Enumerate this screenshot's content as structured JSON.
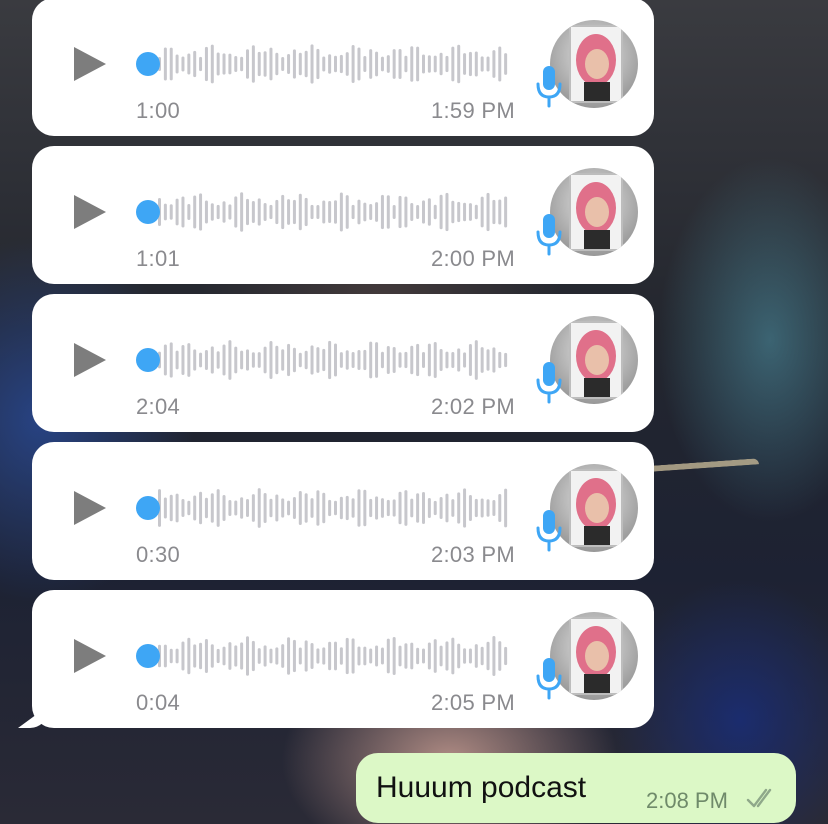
{
  "wallpaper": {
    "description_colors": {
      "accent_blue": "#4a6fb0",
      "skin": "#c9a190"
    }
  },
  "voice_messages": [
    {
      "duration": "1:00",
      "time": "1:59 PM",
      "progress": 0
    },
    {
      "duration": "1:01",
      "time": "2:00 PM",
      "progress": 0
    },
    {
      "duration": "2:04",
      "time": "2:02 PM",
      "progress": 0
    },
    {
      "duration": "0:30",
      "time": "2:03 PM",
      "progress": 0
    },
    {
      "duration": "0:04",
      "time": "2:05 PM",
      "progress": 0
    }
  ],
  "icons": {
    "play": "play-icon",
    "mic": "microphone-icon",
    "ticks": "double-check-icon"
  },
  "colors": {
    "incoming_bubble": "#ffffff",
    "outgoing_bubble": "#dcf8c6",
    "waveform": "#c7c7cc",
    "scrubber": "#3ea6f5",
    "mic": "#3ea6f5",
    "meta_text": "#8a8a8e"
  },
  "sent_message": {
    "text": "Huuum podcast",
    "time": "2:08 PM"
  }
}
